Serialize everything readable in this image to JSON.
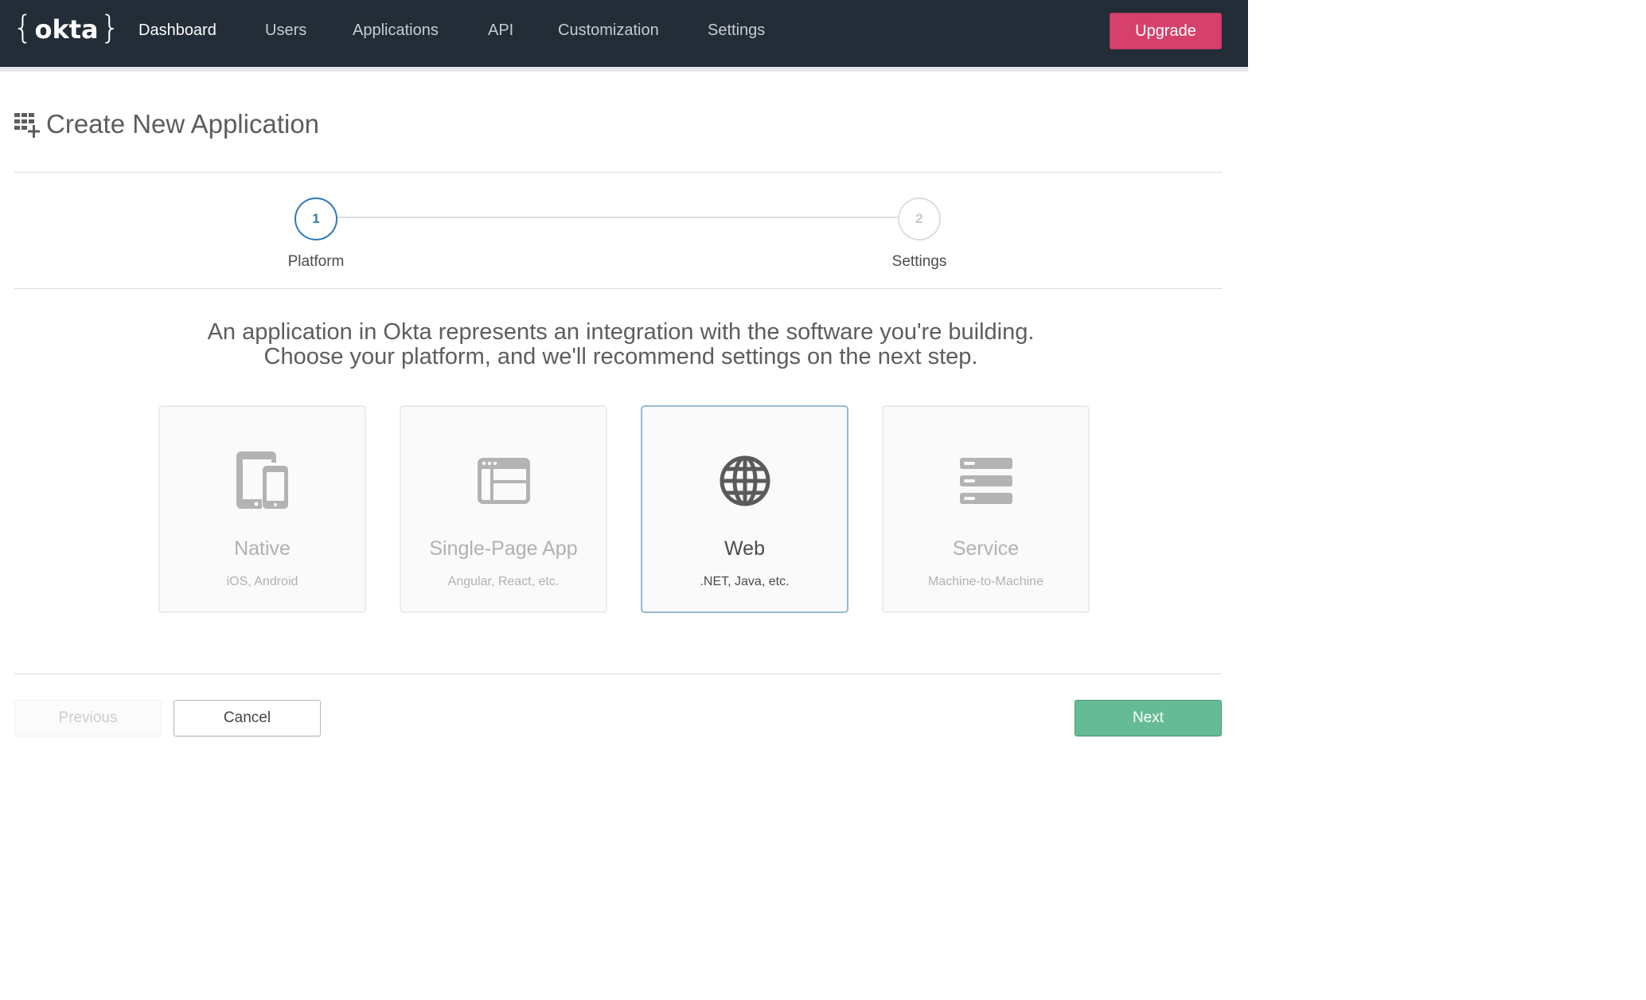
{
  "brand": {
    "logo_text": "okta",
    "colors": {
      "nav_bg": "#222d37",
      "upgrade": "#d5416b",
      "active_step": "#2f7ab9",
      "next_button": "#65bb96",
      "selected_card_border": "#9ab9d2"
    }
  },
  "nav": {
    "items": [
      {
        "label": "Dashboard",
        "active": true
      },
      {
        "label": "Users",
        "active": false
      },
      {
        "label": "Applications",
        "active": false
      },
      {
        "label": "API",
        "active": false
      },
      {
        "label": "Customization",
        "active": false
      },
      {
        "label": "Settings",
        "active": false
      }
    ],
    "upgrade_label": "Upgrade"
  },
  "page": {
    "title": "Create New Application",
    "title_icon": "add-apps-grid-icon"
  },
  "stepper": {
    "current_step": 1,
    "steps": [
      {
        "number": "1",
        "label": "Platform"
      },
      {
        "number": "2",
        "label": "Settings"
      }
    ]
  },
  "intro": {
    "line1": "An application in Okta represents an integration with the software you're building.",
    "line2": "Choose your platform, and we'll recommend settings on the next step."
  },
  "platforms": [
    {
      "name": "Native",
      "subtitle": "iOS, Android",
      "icon": "mobile-devices-icon",
      "selected": false
    },
    {
      "name": "Single-Page App",
      "subtitle": "Angular, React, etc.",
      "icon": "browser-window-icon",
      "selected": false
    },
    {
      "name": "Web",
      "subtitle": ".NET, Java, etc.",
      "icon": "globe-icon",
      "selected": true
    },
    {
      "name": "Service",
      "subtitle": "Machine-to-Machine",
      "icon": "server-stack-icon",
      "selected": false
    }
  ],
  "footer": {
    "previous_label": "Previous",
    "previous_disabled": true,
    "cancel_label": "Cancel",
    "next_label": "Next"
  }
}
